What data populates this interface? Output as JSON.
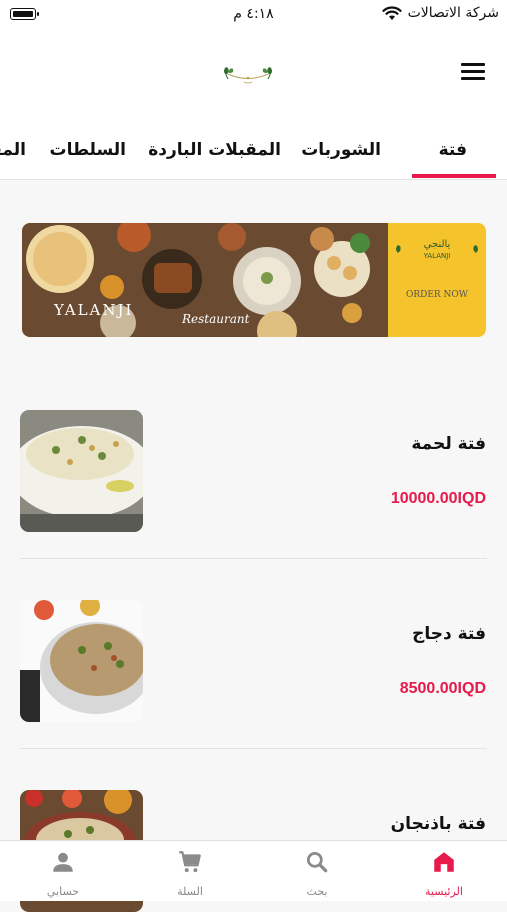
{
  "status_bar": {
    "time": "٤:١٨ م",
    "carrier": "شركة الاتصالات"
  },
  "header": {
    "logo": "yalanji-leaf-logo",
    "menu_icon": "hamburger-menu-icon"
  },
  "tabs": [
    {
      "label": "فتة",
      "active": true
    },
    {
      "label": "الشوربات",
      "active": false
    },
    {
      "label": "المقبلات الباردة",
      "active": false
    },
    {
      "label": "السلطات",
      "active": false
    },
    {
      "label": "المقبلات الحارة",
      "active": false
    }
  ],
  "banner": {
    "brand": "YALANJI",
    "brand_sub": "Restaurant",
    "logo_arabic": "يالنجي",
    "cta": "ORDER NOW"
  },
  "menu_items": [
    {
      "name": "فتة لحمة",
      "price": "10000.00IQD"
    },
    {
      "name": "فتة دجاج",
      "price": "8500.00IQD"
    },
    {
      "name": "فتة باذنجان",
      "price": ""
    }
  ],
  "bottom_nav": [
    {
      "label": "الرئيسية",
      "icon": "home-icon",
      "active": true
    },
    {
      "label": "بحث",
      "icon": "search-icon",
      "active": false
    },
    {
      "label": "السلة",
      "icon": "cart-icon",
      "active": false
    },
    {
      "label": "حسابي",
      "icon": "person-icon",
      "active": false
    }
  ],
  "colors": {
    "accent": "#e8194b",
    "banner_yellow": "#f5c42c"
  }
}
